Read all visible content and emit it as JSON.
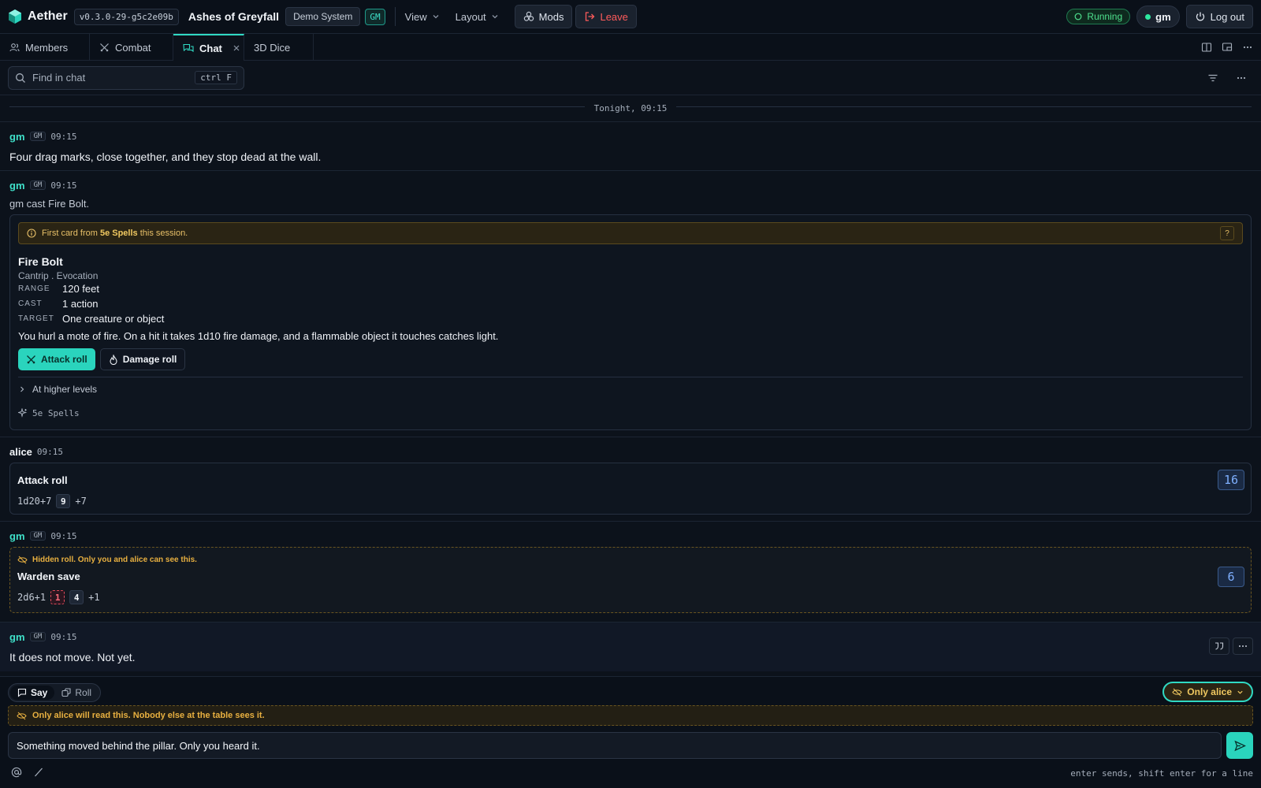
{
  "app": {
    "name": "Aether",
    "version": "v0.3.0-29-g5c2e09b",
    "campaign": "Ashes of Greyfall",
    "system": "Demo System",
    "role_badge": "GM",
    "menus": {
      "view": "View",
      "layout": "Layout"
    },
    "mods_label": "Mods",
    "leave_label": "Leave",
    "status": "Running",
    "user": "gm",
    "logout_label": "Log out"
  },
  "tabs": [
    {
      "label": "Members"
    },
    {
      "label": "Combat"
    },
    {
      "label": "Chat",
      "active": true
    },
    {
      "label": "3D Dice"
    }
  ],
  "search": {
    "placeholder": "Find in chat",
    "shortcut": "ctrl F"
  },
  "chat": {
    "day_separator": "Tonight, 09:15",
    "messages": [
      {
        "author": "gm",
        "role": "GM",
        "time": "09:15",
        "text": "Four drag marks, close together, and they stop dead at the wall."
      },
      {
        "author": "gm",
        "role": "GM",
        "time": "09:15",
        "text": "gm cast Fire Bolt.",
        "card": {
          "notice_prefix": "First card from ",
          "notice_source": "5e Spells",
          "notice_suffix": " this session.",
          "help": "?",
          "name": "Fire Bolt",
          "kind": "Cantrip . Evocation",
          "props": [
            {
              "key": "RANGE",
              "value": "120 feet"
            },
            {
              "key": "CAST",
              "value": "1 action"
            },
            {
              "key": "TARGET",
              "value": "One creature or object"
            }
          ],
          "description": "You hurl a mote of fire. On a hit it takes 1d10 fire damage, and a flammable object it touches catches light.",
          "attack_label": "Attack roll",
          "damage_label": "Damage roll",
          "higher_levels": "At higher levels",
          "source": "5e Spells"
        }
      },
      {
        "author": "alice",
        "time": "09:15",
        "roll": {
          "title": "Attack roll",
          "formula": "1d20+7",
          "dice": [
            "9"
          ],
          "modifier": "+7",
          "total": "16"
        }
      },
      {
        "author": "gm",
        "role": "GM",
        "time": "09:15",
        "roll": {
          "hidden_note": "Hidden roll. Only you and alice can see this.",
          "title": "Warden save",
          "formula": "2d6+1",
          "dice": [
            "1",
            "4"
          ],
          "modifier": "+1",
          "total": "6"
        }
      },
      {
        "author": "gm",
        "role": "GM",
        "time": "09:15",
        "text": "It does not move. Not yet."
      }
    ]
  },
  "composer": {
    "say_label": "Say",
    "roll_label": "Roll",
    "recipient": "Only alice",
    "private_note": "Only alice will read this. Nobody else at the table sees it.",
    "value": "Something moved behind the pillar. Only you heard it.",
    "hint": "enter sends, shift enter for a line"
  },
  "colors": {
    "accent": "#2ad4bd",
    "danger": "#ff5b5b",
    "warning": "#e8b040",
    "running": "#4ee08d"
  }
}
